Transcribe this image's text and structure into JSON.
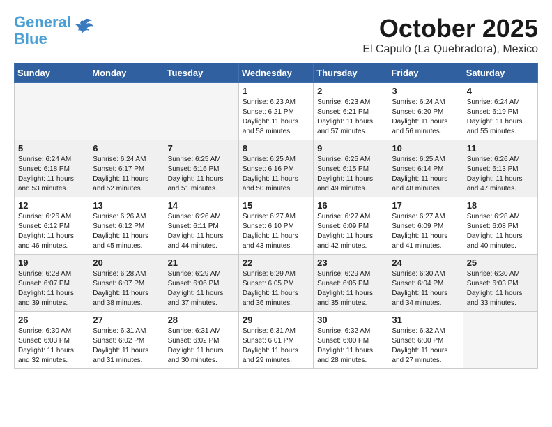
{
  "logo": {
    "general": "General",
    "blue": "Blue"
  },
  "header": {
    "month": "October 2025",
    "location": "El Capulo (La Quebradora), Mexico"
  },
  "weekdays": [
    "Sunday",
    "Monday",
    "Tuesday",
    "Wednesday",
    "Thursday",
    "Friday",
    "Saturday"
  ],
  "weeks": [
    [
      {
        "day": "",
        "info": ""
      },
      {
        "day": "",
        "info": ""
      },
      {
        "day": "",
        "info": ""
      },
      {
        "day": "1",
        "info": "Sunrise: 6:23 AM\nSunset: 6:21 PM\nDaylight: 11 hours\nand 58 minutes."
      },
      {
        "day": "2",
        "info": "Sunrise: 6:23 AM\nSunset: 6:21 PM\nDaylight: 11 hours\nand 57 minutes."
      },
      {
        "day": "3",
        "info": "Sunrise: 6:24 AM\nSunset: 6:20 PM\nDaylight: 11 hours\nand 56 minutes."
      },
      {
        "day": "4",
        "info": "Sunrise: 6:24 AM\nSunset: 6:19 PM\nDaylight: 11 hours\nand 55 minutes."
      }
    ],
    [
      {
        "day": "5",
        "info": "Sunrise: 6:24 AM\nSunset: 6:18 PM\nDaylight: 11 hours\nand 53 minutes."
      },
      {
        "day": "6",
        "info": "Sunrise: 6:24 AM\nSunset: 6:17 PM\nDaylight: 11 hours\nand 52 minutes."
      },
      {
        "day": "7",
        "info": "Sunrise: 6:25 AM\nSunset: 6:16 PM\nDaylight: 11 hours\nand 51 minutes."
      },
      {
        "day": "8",
        "info": "Sunrise: 6:25 AM\nSunset: 6:16 PM\nDaylight: 11 hours\nand 50 minutes."
      },
      {
        "day": "9",
        "info": "Sunrise: 6:25 AM\nSunset: 6:15 PM\nDaylight: 11 hours\nand 49 minutes."
      },
      {
        "day": "10",
        "info": "Sunrise: 6:25 AM\nSunset: 6:14 PM\nDaylight: 11 hours\nand 48 minutes."
      },
      {
        "day": "11",
        "info": "Sunrise: 6:26 AM\nSunset: 6:13 PM\nDaylight: 11 hours\nand 47 minutes."
      }
    ],
    [
      {
        "day": "12",
        "info": "Sunrise: 6:26 AM\nSunset: 6:12 PM\nDaylight: 11 hours\nand 46 minutes."
      },
      {
        "day": "13",
        "info": "Sunrise: 6:26 AM\nSunset: 6:12 PM\nDaylight: 11 hours\nand 45 minutes."
      },
      {
        "day": "14",
        "info": "Sunrise: 6:26 AM\nSunset: 6:11 PM\nDaylight: 11 hours\nand 44 minutes."
      },
      {
        "day": "15",
        "info": "Sunrise: 6:27 AM\nSunset: 6:10 PM\nDaylight: 11 hours\nand 43 minutes."
      },
      {
        "day": "16",
        "info": "Sunrise: 6:27 AM\nSunset: 6:09 PM\nDaylight: 11 hours\nand 42 minutes."
      },
      {
        "day": "17",
        "info": "Sunrise: 6:27 AM\nSunset: 6:09 PM\nDaylight: 11 hours\nand 41 minutes."
      },
      {
        "day": "18",
        "info": "Sunrise: 6:28 AM\nSunset: 6:08 PM\nDaylight: 11 hours\nand 40 minutes."
      }
    ],
    [
      {
        "day": "19",
        "info": "Sunrise: 6:28 AM\nSunset: 6:07 PM\nDaylight: 11 hours\nand 39 minutes."
      },
      {
        "day": "20",
        "info": "Sunrise: 6:28 AM\nSunset: 6:07 PM\nDaylight: 11 hours\nand 38 minutes."
      },
      {
        "day": "21",
        "info": "Sunrise: 6:29 AM\nSunset: 6:06 PM\nDaylight: 11 hours\nand 37 minutes."
      },
      {
        "day": "22",
        "info": "Sunrise: 6:29 AM\nSunset: 6:05 PM\nDaylight: 11 hours\nand 36 minutes."
      },
      {
        "day": "23",
        "info": "Sunrise: 6:29 AM\nSunset: 6:05 PM\nDaylight: 11 hours\nand 35 minutes."
      },
      {
        "day": "24",
        "info": "Sunrise: 6:30 AM\nSunset: 6:04 PM\nDaylight: 11 hours\nand 34 minutes."
      },
      {
        "day": "25",
        "info": "Sunrise: 6:30 AM\nSunset: 6:03 PM\nDaylight: 11 hours\nand 33 minutes."
      }
    ],
    [
      {
        "day": "26",
        "info": "Sunrise: 6:30 AM\nSunset: 6:03 PM\nDaylight: 11 hours\nand 32 minutes."
      },
      {
        "day": "27",
        "info": "Sunrise: 6:31 AM\nSunset: 6:02 PM\nDaylight: 11 hours\nand 31 minutes."
      },
      {
        "day": "28",
        "info": "Sunrise: 6:31 AM\nSunset: 6:02 PM\nDaylight: 11 hours\nand 30 minutes."
      },
      {
        "day": "29",
        "info": "Sunrise: 6:31 AM\nSunset: 6:01 PM\nDaylight: 11 hours\nand 29 minutes."
      },
      {
        "day": "30",
        "info": "Sunrise: 6:32 AM\nSunset: 6:00 PM\nDaylight: 11 hours\nand 28 minutes."
      },
      {
        "day": "31",
        "info": "Sunrise: 6:32 AM\nSunset: 6:00 PM\nDaylight: 11 hours\nand 27 minutes."
      },
      {
        "day": "",
        "info": ""
      }
    ]
  ]
}
